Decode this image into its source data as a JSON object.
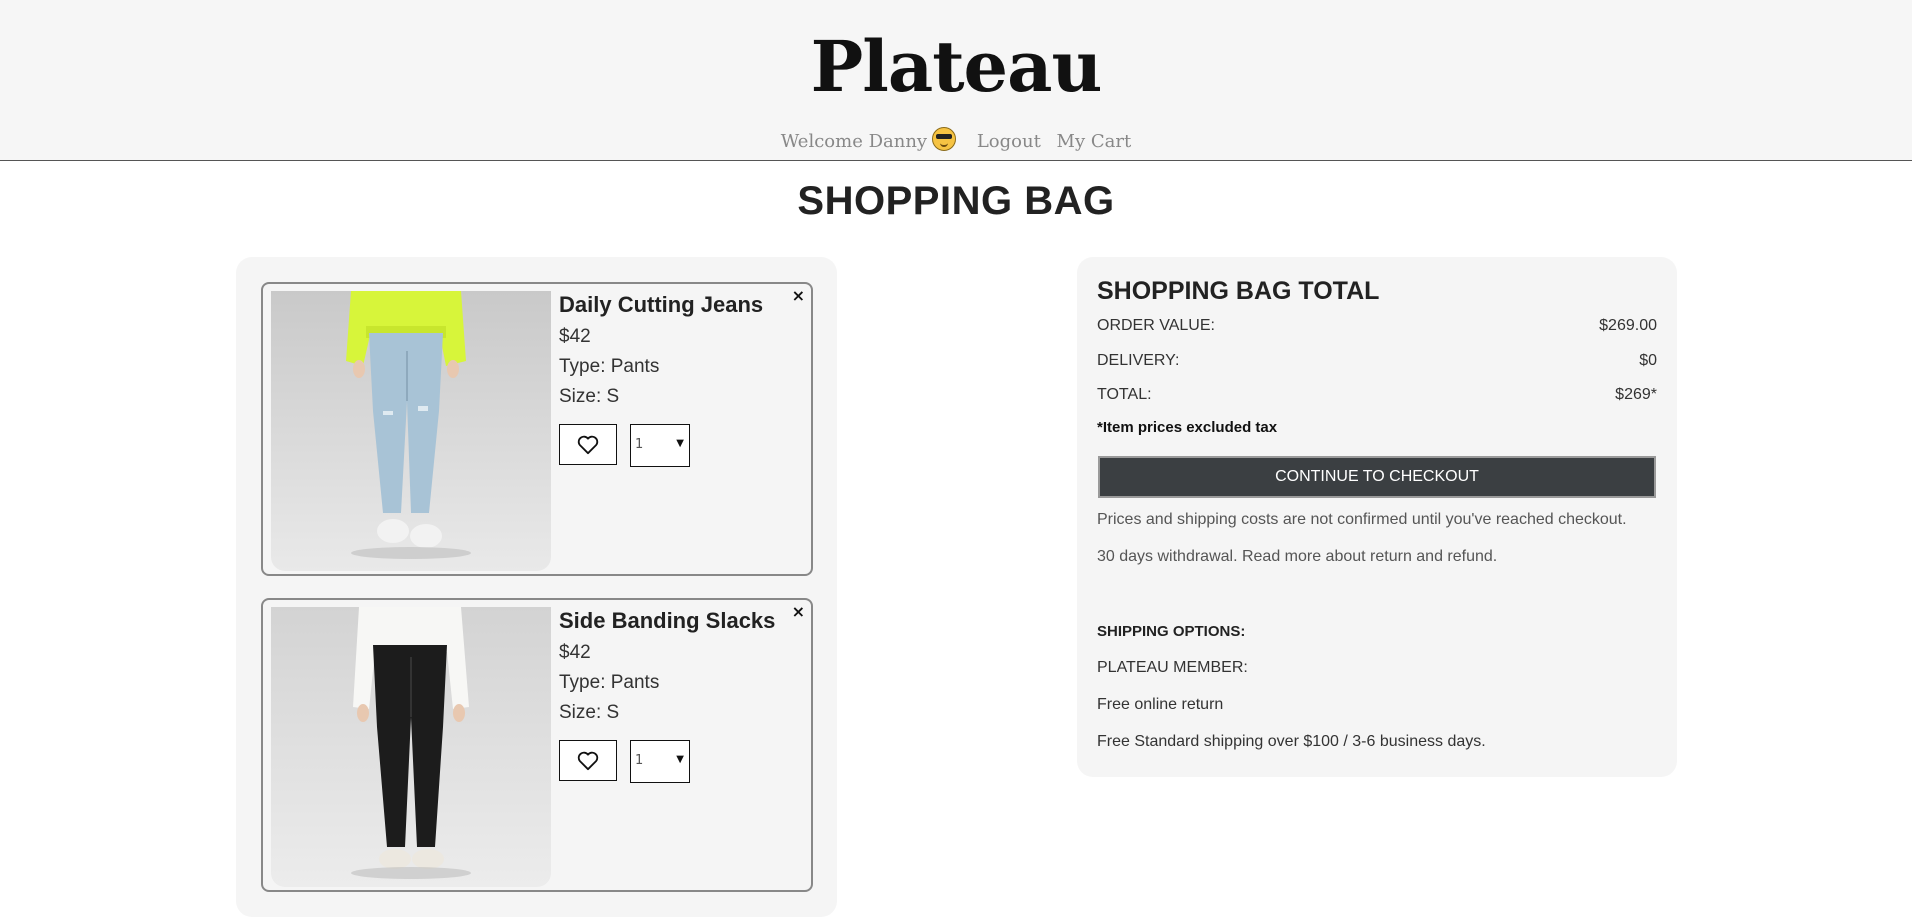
{
  "header": {
    "logo": "Plateau",
    "welcome": "Welcome Danny",
    "logout": "Logout",
    "cart": "My Cart"
  },
  "page_title": "SHOPPING BAG",
  "items": [
    {
      "name": "Daily Cutting Jeans",
      "price": "$42",
      "type": "Type: Pants",
      "size": "Size: S",
      "quantity": "1",
      "remove": "×"
    },
    {
      "name": "Side Banding Slacks",
      "price": "$42",
      "type": "Type: Pants",
      "size": "Size: S",
      "quantity": "1",
      "remove": "×"
    }
  ],
  "summary": {
    "title": "SHOPPING BAG TOTAL",
    "order_value_label": "ORDER VALUE:",
    "order_value": "$269.00",
    "delivery_label": "DELIVERY:",
    "delivery": "$0",
    "total_label": "TOTAL:",
    "total": "$269*",
    "tax_note": "*Item prices excluded tax",
    "checkout_label": "CONTINUE TO CHECKOUT",
    "info_prices": "Prices and shipping costs are not confirmed until you've reached checkout.",
    "info_withdrawal": "30 days withdrawal. Read more about return and refund.",
    "shipping_title": "SHIPPING OPTIONS:",
    "member_label": "PLATEAU MEMBER:",
    "free_return": "Free online return",
    "free_shipping": "Free Standard shipping over $100 / 3-6 business days."
  },
  "colors": {
    "header_bg": "#f6f6f6",
    "panel_bg": "#f5f5f5",
    "checkout_bg": "#3b3f42"
  }
}
